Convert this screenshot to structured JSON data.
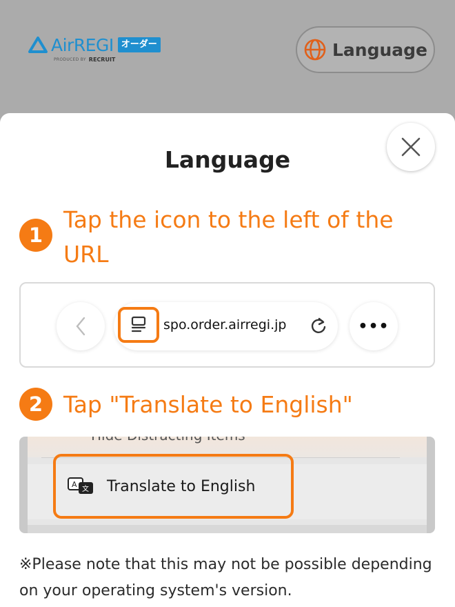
{
  "header": {
    "logo": {
      "brand": "AirREGI",
      "tag": "オーダー",
      "produced_by": "PRODUCED BY",
      "company": "RECRUIT"
    },
    "language_button": {
      "label": "Language",
      "icon": "globe-icon"
    }
  },
  "modal": {
    "title": "Language",
    "close_icon": "close-icon",
    "steps": [
      {
        "number": "1",
        "text": "Tap the icon to the left of the URL"
      },
      {
        "number": "2",
        "text": "Tap \"Translate to English\""
      }
    ],
    "screenshot1": {
      "url": "spo.order.airregi.jp",
      "icons": [
        "back-chevron-icon",
        "reader-mode-icon",
        "reload-icon",
        "more-icon"
      ],
      "more_label": "•••"
    },
    "screenshot2": {
      "partial_item": "Hide Distracting Items",
      "menu_item": "Translate to English",
      "icon": "translate-icon"
    },
    "note": "※Please note that this may not be possible depending on your operating system's version."
  },
  "colors": {
    "accent": "#f57b14",
    "brand_blue": "#1f8fcf",
    "overlay": "#ababab"
  }
}
